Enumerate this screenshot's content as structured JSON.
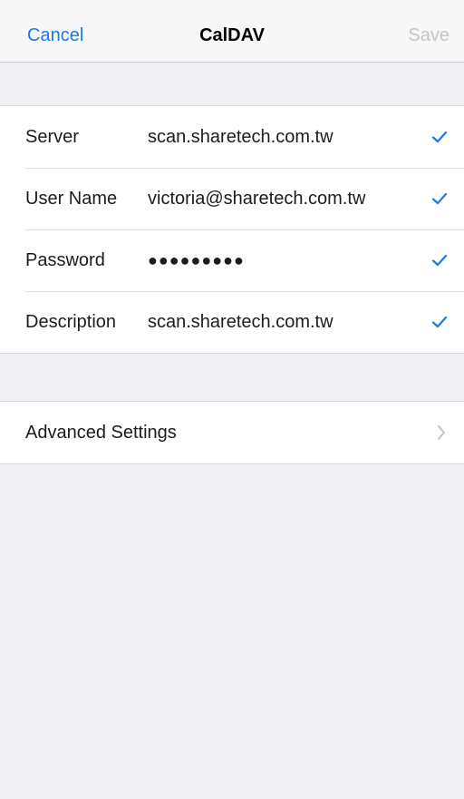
{
  "navbar": {
    "cancel_label": "Cancel",
    "title": "CalDAV",
    "save_label": "Save"
  },
  "fields": [
    {
      "label": "Server",
      "value": "scan.sharetech.com.tw",
      "validated": true
    },
    {
      "label": "User Name",
      "value": "victoria@sharetech.com.tw",
      "validated": true
    },
    {
      "label": "Password",
      "value": "●●●●●●●●●",
      "validated": true
    },
    {
      "label": "Description",
      "value": "scan.sharetech.com.tw",
      "validated": true
    }
  ],
  "advanced": {
    "label": "Advanced Settings"
  },
  "icons": {
    "field_status": "checkmark-icon",
    "disclosure": "chevron-right-icon"
  },
  "colors": {
    "accent": "#1f7ae0",
    "disabled": "#c4c4c8",
    "background": "#efeff4",
    "cell": "#ffffff"
  }
}
